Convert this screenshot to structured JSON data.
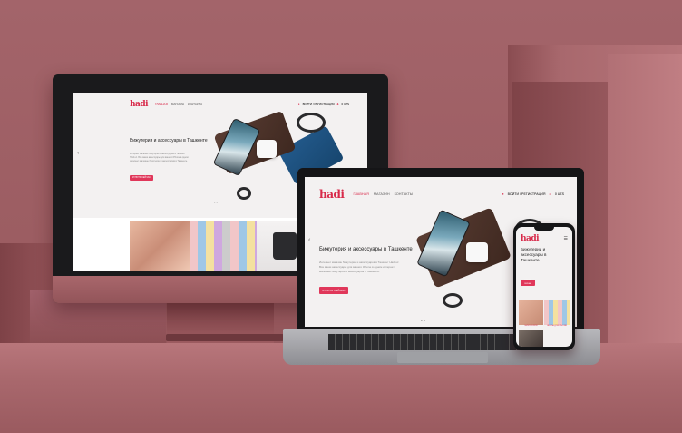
{
  "site": {
    "logo": "hadi",
    "nav": [
      "ГЛАВНАЯ",
      "МАГАЗИН",
      "КОНТАКТЫ"
    ],
    "account": "ВОЙТИ / РЕГИСТРАЦИЯ",
    "cart_total": "0 UZS",
    "hero_title": "Бижутерия и аксессуары в Ташкенте",
    "hero_text": "Интернет магазин бижутерии и аксессуаров в Ташкент Hadi.uz. Все ваши аксессуары для вашего iPhone в одном интернет магазине бижутерии и аксессуаров в Ташкенте.",
    "cta": "КУПИТЬ СЕЙЧАС",
    "mobile_hero_title": "Бижутерии и аксессуары в Ташкенте",
    "mobile_cta": "КУПИТЬ СЕЙЧАС",
    "mobile_categories": [
      "БИЖУТЕРИЯ",
      "ЧЕХЛЫ ДЛЯ IPHONE"
    ]
  },
  "colors": {
    "accent": "#d82a4a",
    "backdrop": "#9c5d62"
  },
  "icons": [
    "user-icon",
    "cart-icon",
    "menu-icon",
    "arrow-left-icon"
  ]
}
